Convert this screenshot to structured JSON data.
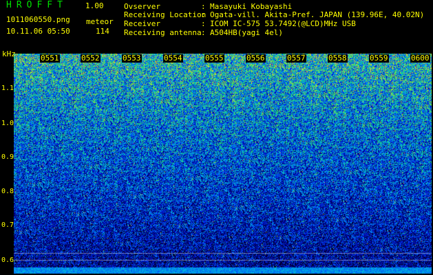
{
  "header": {
    "app_title": "HROFFT",
    "app_version": "1.00",
    "file_name": "1011060550.png",
    "mode": "meteor",
    "datetime": "10.11.06 05:50",
    "count": "114"
  },
  "metadata": [
    {
      "key": "Ovserver",
      "value": "Masayuki Kobayashi"
    },
    {
      "key": "Receiving Location",
      "value": "Ogata-vill. Akita-Pref. JAPAN (139.96E, 40.02N)"
    },
    {
      "key": "Receiver",
      "value": "ICOM IC-575 53.7492(@LCD)MHz USB"
    },
    {
      "key": "Receiving antenna",
      "value": "A504HB(yagi 4el)"
    }
  ],
  "axis": {
    "unit": "kHz",
    "y_ticks": [
      "1.1",
      "1.0",
      "0.9",
      "0.8",
      "0.7",
      "0.6"
    ],
    "time_labels": [
      "0551",
      "0552",
      "0553",
      "0554",
      "0555",
      "0556",
      "0557",
      "0558",
      "0559",
      "0600"
    ]
  },
  "colors": {
    "background": "#000000",
    "text": "#ffff00",
    "title": "#00e000"
  }
}
